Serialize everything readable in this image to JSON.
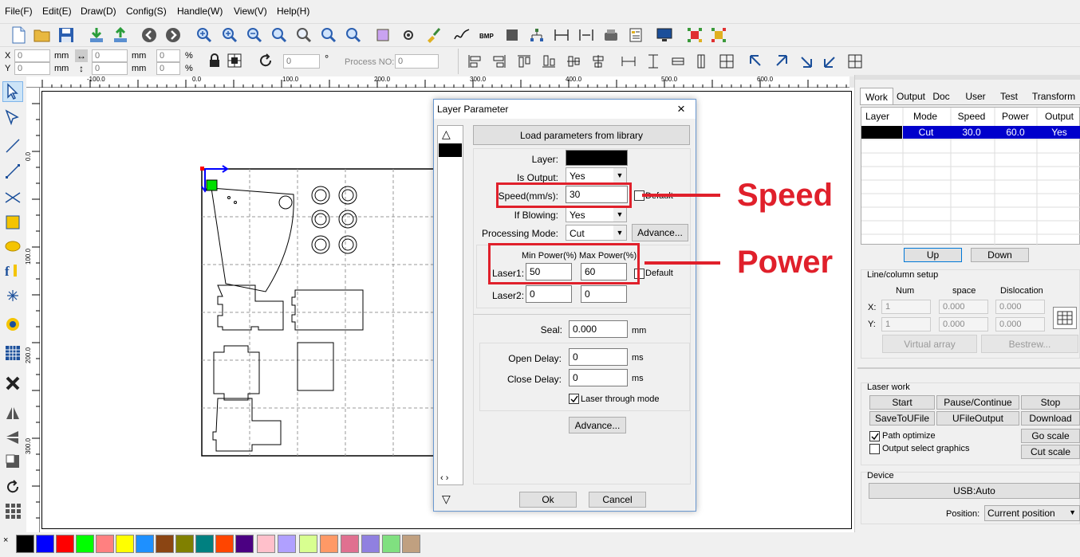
{
  "menu": [
    "File(F)",
    "Edit(E)",
    "Draw(D)",
    "Config(S)",
    "Handle(W)",
    "View(V)",
    "Help(H)"
  ],
  "coords": {
    "x_label": "X",
    "y_label": "Y",
    "x_value": "0",
    "y_value": "0",
    "w_value": "0",
    "h_value": "0",
    "unit_mm": "mm",
    "pct_x": "0",
    "pct_y": "0",
    "unit_pct": "%",
    "angle": "0",
    "degree": "°",
    "process_label": "Process NO:",
    "process_value": "0"
  },
  "ruler": {
    "top_ticks": [
      "-100.0",
      "0.0",
      "100.0",
      "200.0",
      "300.0",
      "400.0",
      "500.0",
      "600.0"
    ],
    "left_ticks": [
      "0.0",
      "100.0",
      "200.0",
      "300.0"
    ]
  },
  "dialog": {
    "title": "Layer Parameter",
    "load_button": "Load parameters from library",
    "layer_label": "Layer:",
    "is_output_label": "Is Output:",
    "is_output_value": "Yes",
    "speed_label": "Speed(mm/s):",
    "speed_value": "30",
    "default_label": "Default",
    "if_blowing_label": "If Blowing:",
    "if_blowing_value": "Yes",
    "processing_mode_label": "Processing Mode:",
    "processing_mode_value": "Cut",
    "advance_button": "Advance...",
    "min_power_label": "Min Power(%)",
    "max_power_label": "Max Power(%)",
    "laser1_label": "Laser1:",
    "laser1_min": "50",
    "laser1_max": "60",
    "laser2_label": "Laser2:",
    "laser2_min": "0",
    "laser2_max": "0",
    "power_default_label": "Default",
    "seal_label": "Seal:",
    "seal_value": "0.000",
    "seal_unit": "mm",
    "open_delay_label": "Open Delay:",
    "open_delay_value": "0",
    "open_unit": "ms",
    "close_delay_label": "Close Delay:",
    "close_delay_value": "0",
    "close_unit": "ms",
    "laser_through_label": "Laser through mode",
    "advance2_button": "Advance...",
    "ok_button": "Ok",
    "cancel_button": "Cancel"
  },
  "annotations": {
    "speed": "Speed",
    "power": "Power"
  },
  "panel": {
    "tabs": [
      "Work",
      "Output",
      "Doc",
      "User",
      "Test",
      "Transform"
    ],
    "columns": [
      "Layer",
      "Mode",
      "Speed",
      "Power",
      "Output"
    ],
    "row": {
      "mode": "Cut",
      "speed": "30.0",
      "power": "60.0",
      "output": "Yes"
    },
    "up": "Up",
    "down": "Down",
    "line_col_title": "Line/column setup",
    "num_label": "Num",
    "space_label": "space",
    "dislocation_label": "Dislocation",
    "x_label": "X:",
    "y_label": "Y:",
    "x_num": "1",
    "x_space": "0.000",
    "x_dis": "0.000",
    "y_num": "1",
    "y_space": "0.000",
    "y_dis": "0.000",
    "virtual_array": "Virtual array",
    "bestrew": "Bestrew...",
    "laser_work_title": "Laser work",
    "start": "Start",
    "pause": "Pause/Continue",
    "stop": "Stop",
    "save_u": "SaveToUFile",
    "ufile_output": "UFileOutput",
    "download": "Download",
    "path_optimize": "Path optimize",
    "output_select": "Output select graphics",
    "go_scale": "Go scale",
    "cut_scale": "Cut scale",
    "device_title": "Device",
    "usb": "USB:Auto",
    "position_label": "Position:",
    "position_value": "Current position"
  },
  "colors": {
    "accent": "#0078d7",
    "selection": "#0000cc",
    "annotation_red": "#e0202b"
  },
  "palette_colors": [
    "#000000",
    "#0000ff",
    "#ff0000",
    "#00ff00",
    "#ff8080",
    "#ffff00",
    "#1e90ff",
    "#8b4513",
    "#808000",
    "#008080",
    "#ff4500",
    "#4b0082",
    "#ffc0cb",
    "#b0a0ff",
    "#d8ff90",
    "#ff9966",
    "#e07090",
    "#9080e0",
    "#80e080",
    "#c0a080"
  ]
}
